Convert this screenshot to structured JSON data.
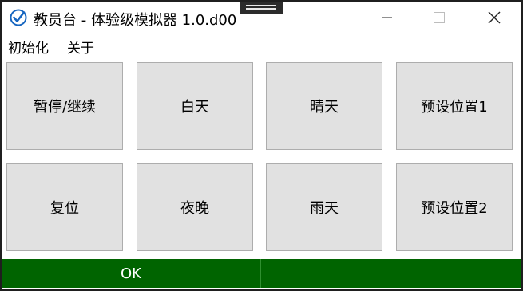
{
  "window": {
    "title": "教员台 - 体验级模拟器 1.0.d00",
    "icon": "check-circle-icon",
    "controls": {
      "minimize": "minimize-icon",
      "maximize": "maximize-icon",
      "close": "close-icon"
    }
  },
  "menu": {
    "items": [
      "初始化",
      "关于"
    ]
  },
  "buttons": {
    "row1": [
      "暂停/继续",
      "白天",
      "晴天",
      "预设位置1"
    ],
    "row2": [
      "复位",
      "夜晚",
      "雨天",
      "预设位置2"
    ]
  },
  "status": {
    "left": "OK",
    "right": ""
  },
  "colors": {
    "status_bg": "#006400",
    "button_bg": "#e1e1e1",
    "icon_blue": "#1565c0"
  }
}
